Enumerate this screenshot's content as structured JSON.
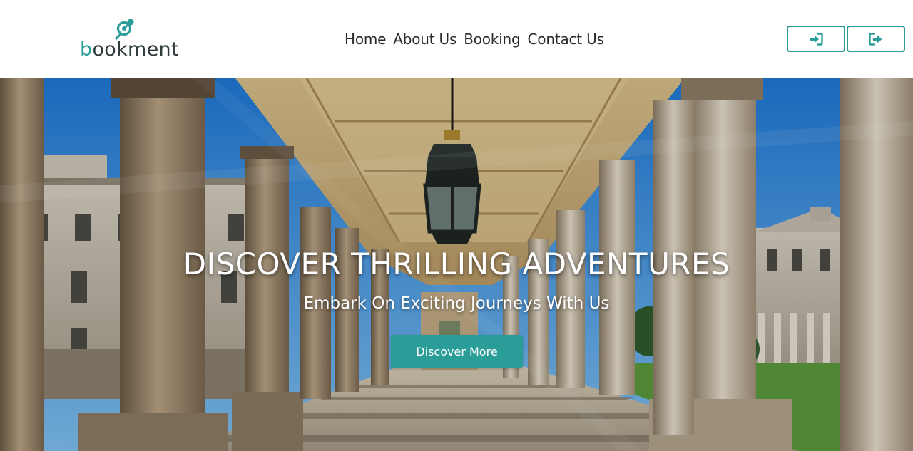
{
  "brand": {
    "name_prefix": "b",
    "name_rest": "ookment",
    "accent_color": "#2a9d99",
    "logo_icon": "map-pin-icon"
  },
  "nav": {
    "items": [
      {
        "label": "Home"
      },
      {
        "label": "About Us"
      },
      {
        "label": "Booking"
      },
      {
        "label": "Contact Us"
      }
    ]
  },
  "auth": {
    "login_icon": "sign-in-icon",
    "logout_icon": "sign-out-icon"
  },
  "hero": {
    "title": "DISCOVER THRILLING ADVENTURES",
    "subtitle": "Embark On Exciting Journeys With Us",
    "cta_label": "Discover More",
    "background": "colonnade-photo"
  }
}
